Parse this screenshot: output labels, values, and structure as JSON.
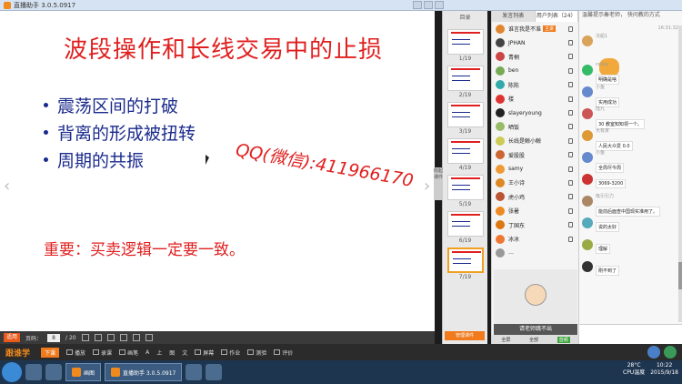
{
  "window": {
    "title": "直播助手 3.0.5.0917"
  },
  "slide": {
    "title": "波段操作和长线交易中的止损",
    "bullets": [
      "震荡区间的打破",
      "背离的形成被扭转",
      "周期的共振"
    ],
    "overlay_text": "QQ(微信):411966170",
    "important": "重要：买卖逻辑一定要一致。",
    "colors": {
      "title": "#e02020",
      "bullets": "#1a2a8c"
    }
  },
  "pager": {
    "tag": "适用",
    "label": "页码：",
    "page": "8",
    "total": "/ 20"
  },
  "thumbnails": {
    "header": "目录",
    "items": [
      {
        "num": "1/19"
      },
      {
        "num": "2/19"
      },
      {
        "num": "3/19"
      },
      {
        "num": "4/19"
      },
      {
        "num": "5/19"
      },
      {
        "num": "6/19"
      },
      {
        "num": "7/19"
      }
    ],
    "side_tab": "收起课件",
    "bottom_button": "管理课件"
  },
  "users": {
    "tabs": [
      "发言列表",
      "用户列表（24）"
    ],
    "list": [
      {
        "name": "谁言我是不准",
        "badge": "主讲"
      },
      {
        "name": "JPHAN"
      },
      {
        "name": "青桐"
      },
      {
        "name": "ben"
      },
      {
        "name": "陈陈"
      },
      {
        "name": "楼"
      },
      {
        "name": "slayeryoung"
      },
      {
        "name": "晒饭"
      },
      {
        "name": "长线是鲸小鲸"
      },
      {
        "name": "爱股股"
      },
      {
        "name": "samy"
      },
      {
        "name": "王小诗"
      },
      {
        "name": "虎小鸡"
      },
      {
        "name": "张暑"
      },
      {
        "name": "丁国东"
      },
      {
        "name": "冰冰"
      },
      {
        "name": "…"
      }
    ],
    "camera_label": "请老师跳不出",
    "footer": [
      "全屏",
      "全部",
      "音频"
    ]
  },
  "chat": {
    "header": "温馨提示秦老师，  快问教的方式",
    "time": "16:31:32",
    "messages": [
      {
        "name": "沉船1",
        "text": ""
      },
      {
        "name": "cosky",
        "text": "明确是啥"
      },
      {
        "name": "小鱼",
        "text": "实用成功"
      },
      {
        "name": "陆九",
        "text": "30 教室知知领一个。"
      },
      {
        "name": "大有家",
        "text": "人民大众爱 0.0"
      },
      {
        "name": "小鱼",
        "text": "全周尽今周"
      },
      {
        "name": "",
        "text": "3069-3200"
      },
      {
        "name": "吸引引力",
        "text": "能前后面查中国现实准用了。"
      },
      {
        "name": "",
        "text": "说的太好"
      },
      {
        "name": "",
        "text": "理解"
      },
      {
        "name": "",
        "text": "刚不到了"
      }
    ]
  },
  "toolbar": {
    "logo": "跟谁学",
    "buttons": [
      "下课",
      "播放",
      "录课",
      "画笔",
      "A",
      "上",
      "图",
      "文",
      "屏幕",
      "作业",
      "测验",
      "评价"
    ]
  },
  "taskbar": {
    "tasks": [
      "画图",
      "直播助手 3.0.5.0917"
    ],
    "temp": "28°C",
    "cpu": "CPU温度",
    "time": "10:22",
    "date": "2015/9/18"
  }
}
